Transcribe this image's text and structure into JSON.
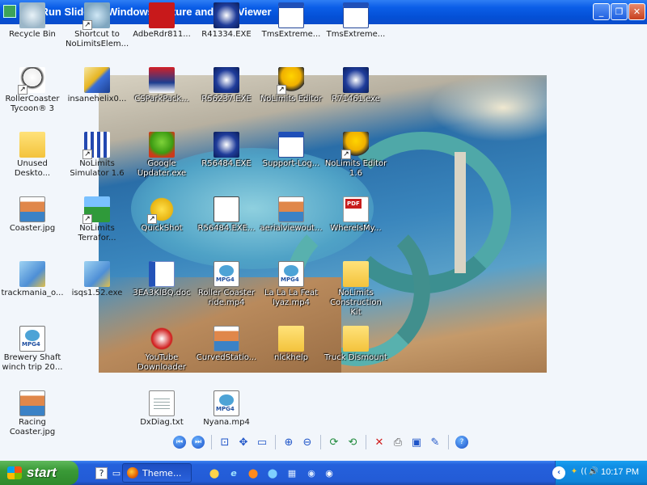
{
  "window": {
    "title": "Q... Run Slide... - Windows Picture and Fax Viewer"
  },
  "desktop_icons": [
    {
      "label": "Recycle Bin"
    },
    {
      "label": "Shortcut to NoLimitsElem..."
    },
    {
      "label": "AdbeRdr811..."
    },
    {
      "label": "R41334.EXE"
    },
    {
      "label": "TmsExtreme..."
    },
    {
      "label": "TmsExtreme..."
    },
    {
      "label": "RollerCoaster Tycoon® 3"
    },
    {
      "label": "insanehelix0..."
    },
    {
      "label": "CSParkPack..."
    },
    {
      "label": "R56237.EXE"
    },
    {
      "label": "NoLimits Editor"
    },
    {
      "label": "R71461.exe"
    },
    {
      "label": "Unused Deskto..."
    },
    {
      "label": "NoLimits Simulator 1.6"
    },
    {
      "label": "Google Updater.exe"
    },
    {
      "label": "R56484.EXE"
    },
    {
      "label": "Support-Log..."
    },
    {
      "label": "NoLimits Editor 1.6"
    },
    {
      "label": "Coaster.jpg"
    },
    {
      "label": "NoLimits Terrafor..."
    },
    {
      "label": "QuickShot"
    },
    {
      "label": "R56484.EXE..."
    },
    {
      "label": "aerialviewout..."
    },
    {
      "label": "WhereIsMy..."
    },
    {
      "label": "trackmania_o..."
    },
    {
      "label": "isqs1.52.exe"
    },
    {
      "label": "3EA3KIBQ.doc"
    },
    {
      "label": "Roller Coaster ride.mp4"
    },
    {
      "label": "La La La Feat Iyaz.mp4"
    },
    {
      "label": "NoLimits Construction Kit"
    },
    {
      "label": "Brewery Shaft winch trip 20..."
    },
    {
      "label": "YouTube Downloader"
    },
    {
      "label": "CurvedStatio..."
    },
    {
      "label": "nlckhelp"
    },
    {
      "label": "Truck Dismount"
    },
    {
      "label": "Racing Coaster.jpg"
    },
    {
      "label": "DxDiag.txt"
    },
    {
      "label": "Nyana.mp4"
    }
  ],
  "icon_tags": {
    "mpg4": "MPG4",
    "pdf": "PDF"
  },
  "viewer_toolbar": {
    "prev": "⏮",
    "next": "⏭",
    "best_fit": "⊡",
    "actual_size": "✥",
    "slideshow": "▭",
    "zoom_in": "⊕",
    "zoom_out": "⊖",
    "rotate_cw": "⟳",
    "rotate_ccw": "⟲",
    "delete": "✕",
    "print": "⎙",
    "save": "▣",
    "edit": "✎",
    "help": "?"
  },
  "window_controls": {
    "minimize": "_",
    "maximize": "❐",
    "close": "✕"
  },
  "taskbar": {
    "start_label": "start",
    "task_button_label": "Theme...",
    "clock": "10:17 PM",
    "quicklaunch": [
      "?",
      "▭",
      "⬤",
      "e",
      "⬤",
      "⬤",
      "▦",
      "◉",
      "◉"
    ],
    "tray": [
      "‹",
      "✦",
      "((",
      "🔊"
    ]
  },
  "colors": {
    "titlebar": "#0450d6",
    "taskbar": "#235bd6",
    "start_button": "#3a9a37",
    "tray": "#0f86da"
  }
}
